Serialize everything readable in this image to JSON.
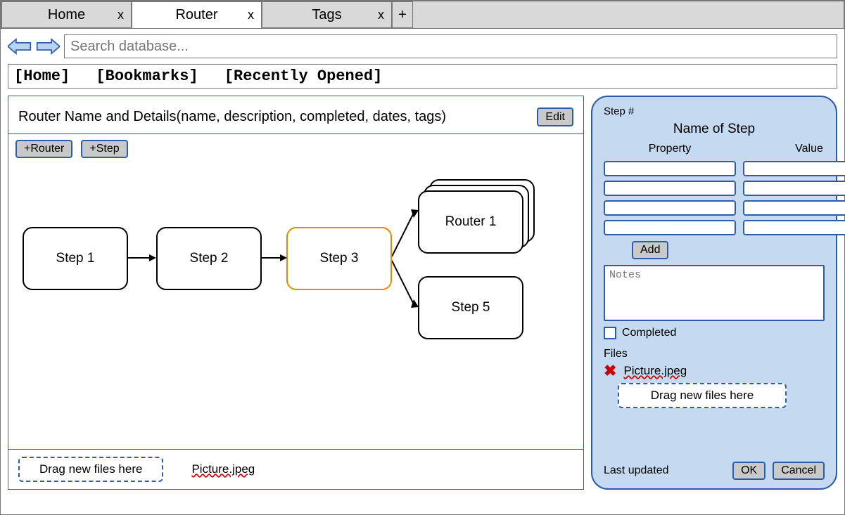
{
  "tabs": [
    {
      "label": "Home",
      "active": false
    },
    {
      "label": "Router",
      "active": true
    },
    {
      "label": "Tags",
      "active": false
    }
  ],
  "tab_close_glyph": "x",
  "tab_add_glyph": "+",
  "search": {
    "placeholder": "Search database..."
  },
  "breadcrumbs": {
    "home": "[Home]",
    "bookmarks": "[Bookmarks]",
    "recent": "[Recently Opened]"
  },
  "router_panel": {
    "title": "Router Name and Details(name, description, completed, dates, tags)",
    "edit_label": "Edit",
    "add_router_label": "+Router",
    "add_step_label": "+Step",
    "nodes": {
      "step1": "Step 1",
      "step2": "Step 2",
      "step3": "Step 3",
      "router1": "Router 1",
      "step5": "Step 5"
    },
    "dropzone_label": "Drag new files here",
    "file_name": "Picture.jpeg"
  },
  "step_panel": {
    "step_num_label": "Step #",
    "title": "Name of Step",
    "col_property": "Property",
    "col_value": "Value",
    "add_label": "Add",
    "notes_placeholder": "Notes",
    "completed_label": "Completed",
    "files_label": "Files",
    "file_name": "Picture.jpeg",
    "dropzone_label": "Drag new files here",
    "last_updated_label": "Last updated",
    "ok_label": "OK",
    "cancel_label": "Cancel"
  }
}
